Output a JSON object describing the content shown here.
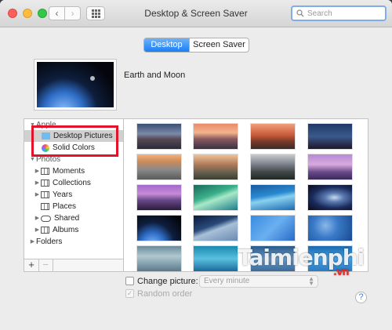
{
  "window": {
    "title": "Desktop & Screen Saver",
    "search_placeholder": "Search"
  },
  "tabs": [
    {
      "label": "Desktop",
      "active": true
    },
    {
      "label": "Screen Saver",
      "active": false
    }
  ],
  "current_picture": {
    "name": "Earth and Moon"
  },
  "sidebar": {
    "items": [
      {
        "label": "Apple",
        "kind": "group",
        "icon": "none"
      },
      {
        "label": "Desktop Pictures",
        "kind": "item",
        "icon": "folder-icon",
        "selected": true
      },
      {
        "label": "Solid Colors",
        "kind": "item",
        "icon": "color-wheel-icon"
      },
      {
        "label": "Photos",
        "kind": "group",
        "icon": "none"
      },
      {
        "label": "Moments",
        "kind": "item",
        "icon": "photo-grid-icon"
      },
      {
        "label": "Collections",
        "kind": "item",
        "icon": "photo-grid-icon"
      },
      {
        "label": "Years",
        "kind": "item",
        "icon": "photo-grid-icon"
      },
      {
        "label": "Places",
        "kind": "item",
        "icon": "photo-grid-icon"
      },
      {
        "label": "Shared",
        "kind": "item",
        "icon": "cloud-icon"
      },
      {
        "label": "Albums",
        "kind": "item",
        "icon": "photo-grid-icon"
      },
      {
        "label": "Folders",
        "kind": "group",
        "icon": "none"
      }
    ],
    "add_label": "+",
    "remove_label": "−"
  },
  "thumbnails": [
    {
      "name": "yosemite-dusk"
    },
    {
      "name": "sierra-sunset"
    },
    {
      "name": "el-capitan-red"
    },
    {
      "name": "night-mountains"
    },
    {
      "name": "half-dome"
    },
    {
      "name": "el-capitan-day"
    },
    {
      "name": "yosemite-valley"
    },
    {
      "name": "purple-peaks"
    },
    {
      "name": "purple-lake"
    },
    {
      "name": "green-wave"
    },
    {
      "name": "blue-wave"
    },
    {
      "name": "galaxy"
    },
    {
      "name": "earth-and-moon"
    },
    {
      "name": "earth-horizon"
    },
    {
      "name": "blue-gradient"
    },
    {
      "name": "blue-bokeh"
    },
    {
      "name": "clouds"
    },
    {
      "name": "water-drops"
    },
    {
      "name": "snowflakes"
    },
    {
      "name": "blue-leaves"
    }
  ],
  "change_picture": {
    "label": "Change picture:",
    "checked": false,
    "interval": "Every minute"
  },
  "random_order": {
    "label": "Random order",
    "checked": true,
    "enabled": false
  },
  "help_label": "?",
  "watermark": {
    "main": "Taimienphi",
    "tld": ".vn"
  }
}
